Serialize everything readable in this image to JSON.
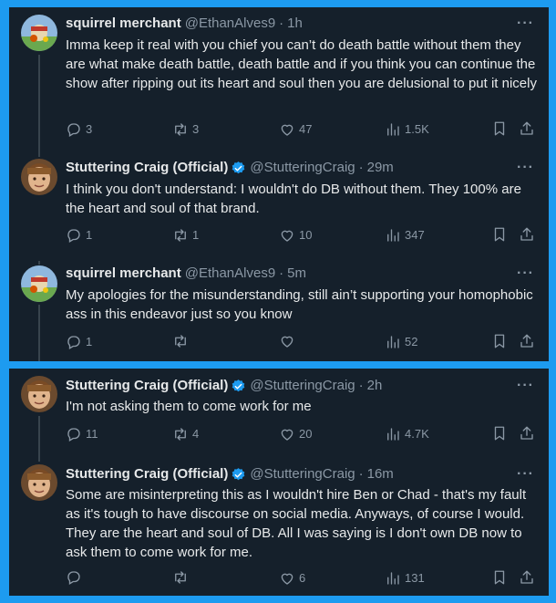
{
  "panels": [
    {
      "tweets": [
        {
          "name": "squirrel merchant",
          "handle": "@EthanAlves9",
          "sep": "·",
          "time": "1h",
          "verified": false,
          "text": "Imma keep it real with you chief you can’t do death battle without them they are what make death battle, death battle and if you think you can continue the show after ripping out its heart and soul then you are delusional to put it nicely",
          "replies": "3",
          "retweets": "3",
          "likes": "47",
          "views": "1.5K"
        },
        {
          "name": "Stuttering Craig (Official)",
          "handle": "@StutteringCraig",
          "sep": "·",
          "time": "29m",
          "verified": true,
          "text": "I think you don't understand: I wouldn't do DB without them. They 100% are the heart and soul of that brand.",
          "replies": "1",
          "retweets": "1",
          "likes": "10",
          "views": "347"
        },
        {
          "name": "squirrel merchant",
          "handle": "@EthanAlves9",
          "sep": "·",
          "time": "5m",
          "verified": false,
          "text": "My apologies for the misunderstanding, still ain’t supporting your homophobic ass in this endeavor just so you know",
          "replies": "1",
          "retweets": "",
          "likes": "",
          "views": "52"
        }
      ]
    },
    {
      "tweets": [
        {
          "name": "Stuttering Craig (Official)",
          "handle": "@StutteringCraig",
          "sep": "·",
          "time": "2h",
          "verified": true,
          "text": "I'm not asking them to come work for me",
          "replies": "11",
          "retweets": "4",
          "likes": "20",
          "views": "4.7K"
        },
        {
          "name": "Stuttering Craig (Official)",
          "handle": "@StutteringCraig",
          "sep": "·",
          "time": "16m",
          "verified": true,
          "text": "Some are misinterpreting this as I wouldn't hire Ben or Chad - that's my fault as it's tough to have discourse on social media. Anyways, of course I would. They are the heart and soul of DB. All I was saying is I don't own DB now to ask them to come work for me.",
          "replies": "",
          "retweets": "",
          "likes": "6",
          "views": "131"
        }
      ]
    }
  ],
  "more_label": "···",
  "icons": {
    "reply": "reply-icon",
    "retweet": "retweet-icon",
    "like": "heart-icon",
    "views": "views-icon",
    "bookmark": "bookmark-icon",
    "share": "share-icon",
    "verified": "verified-badge-icon"
  },
  "colors": {
    "background": "#15202b",
    "frame": "#1d9bf0",
    "text": "#e7e9ea",
    "muted": "#8b98a5",
    "verified": "#1d9bf0"
  }
}
